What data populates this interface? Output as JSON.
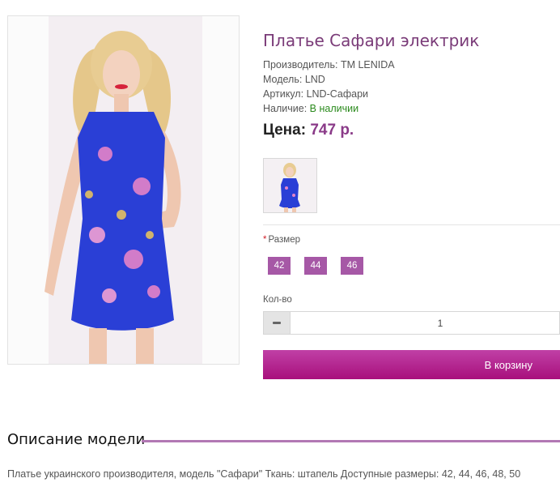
{
  "product": {
    "title": "Платье Сафари электрик",
    "manufacturer_label": "Производитель:",
    "manufacturer": "TM LENIDA",
    "model_label": "Модель:",
    "model": "LND",
    "sku_label": "Артикул:",
    "sku": "LND-Сафари",
    "availability_label": "Наличие:",
    "availability": "В наличии",
    "price_label": "Цена:",
    "price": "747 р."
  },
  "options": {
    "size_label": "Размер",
    "required_mark": "*",
    "sizes": [
      "42",
      "44",
      "46"
    ]
  },
  "quantity": {
    "label": "Кол-во",
    "value": "1"
  },
  "cart": {
    "button_label": "В корзину"
  },
  "description": {
    "heading": "Описание модели",
    "text": "Платье украинского производителя, модель \"Сафари\" Ткань: штапель Доступные размеры: 42, 44, 46, 48, 50"
  },
  "colors": {
    "title": "#7a3b78",
    "accent": "#a658a6",
    "in_stock": "#2a8a1c",
    "dress": "#2a3fd6"
  },
  "icons": {
    "minus": "minus-icon"
  }
}
